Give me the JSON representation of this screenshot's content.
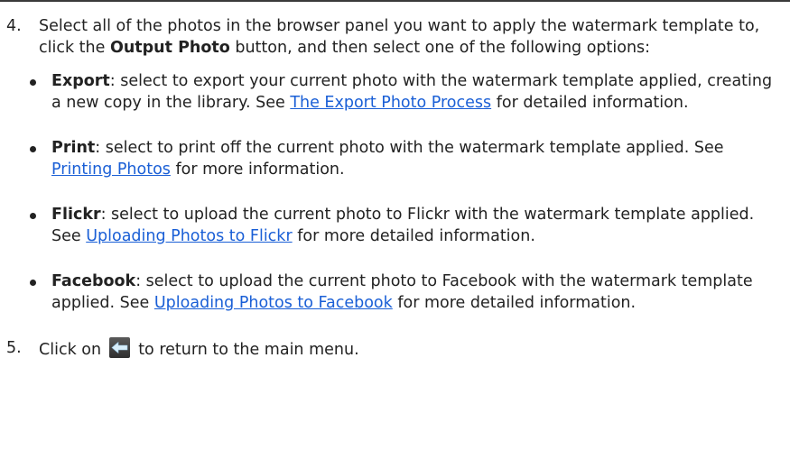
{
  "steps": [
    {
      "number": "4.",
      "text_before": "Select all of the photos in the browser panel you want to apply the watermark template to, click the ",
      "bold": "Output Photo",
      "text_after": " button, and then select one of the following options:"
    },
    {
      "number": "5.",
      "text_before": "Click on ",
      "icon": "back-arrow-icon",
      "text_after": " to return to the main menu."
    }
  ],
  "options": [
    {
      "term": "Export",
      "desc_before": ": select to export your current photo with the watermark template applied, creating a new copy in the library. See ",
      "link": "The Export Photo Process",
      "desc_after": " for detailed information."
    },
    {
      "term": "Print",
      "desc_before": ": select to print off the current photo with the watermark template applied. See ",
      "link": "Printing Photos",
      "desc_after": " for more information."
    },
    {
      "term": "Flickr",
      "desc_before": ": select to upload the current photo to Flickr with the watermark template applied. See ",
      "link": "Uploading Photos to Flickr",
      "desc_after": " for more detailed information."
    },
    {
      "term": "Facebook",
      "desc_before": ": select to upload the current photo to Facebook with the watermark template applied. See ",
      "link": "Uploading Photos to Facebook",
      "desc_after": " for more detailed information."
    }
  ],
  "colors": {
    "text": "#222222",
    "link": "#1a5fd6",
    "icon_bg": "#3a3a3a",
    "icon_arrow": "#cfe8f7"
  }
}
